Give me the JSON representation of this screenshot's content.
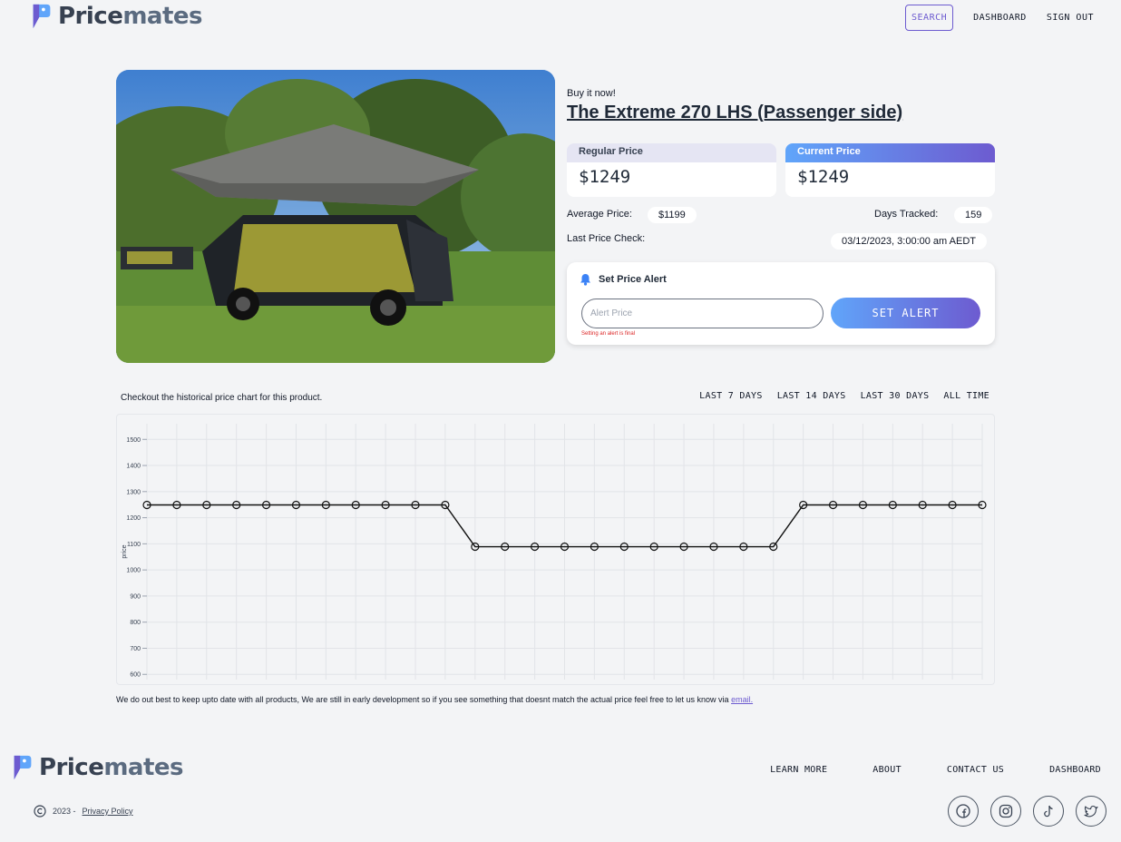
{
  "brand": {
    "name_part1": "Price",
    "name_part2": "mates"
  },
  "nav": {
    "search": "SEARCH",
    "dashboard": "DASHBOARD",
    "sign_out": "SIGN OUT"
  },
  "product": {
    "buy_label": "Buy it now!",
    "title": "The Extreme 270 LHS (Passenger side)",
    "regular_label": "Regular Price",
    "regular_price": "$1249",
    "current_label": "Current Price",
    "current_price": "$1249",
    "average_label": "Average Price:",
    "average_price": "$1199",
    "days_label": "Days Tracked:",
    "days_tracked": "159",
    "last_check_label": "Last Price Check:",
    "last_check": "03/12/2023, 3:00:00 am AEDT"
  },
  "alert": {
    "title": "Set Price Alert",
    "placeholder": "Alert Price",
    "note": "Setting an alert is final",
    "button": "SET ALERT"
  },
  "chart_section": {
    "caption": "Checkout the historical price chart for this product.",
    "ranges": [
      "LAST 7 DAYS",
      "LAST 14 DAYS",
      "LAST 30 DAYS",
      "ALL TIME"
    ],
    "disclaimer": "We do out best to keep upto date with all products, We are still in early development so if you see something that doesnt match the actual price feel free to let us know via",
    "email_link": "email."
  },
  "chart_data": {
    "type": "line",
    "ylabel": "price",
    "ylim": [
      580,
      1560
    ],
    "yticks": [
      600,
      700,
      800,
      900,
      1000,
      1100,
      1200,
      1300,
      1400,
      1500
    ],
    "values": [
      1249,
      1249,
      1249,
      1249,
      1249,
      1249,
      1249,
      1249,
      1249,
      1249,
      1249,
      1089,
      1089,
      1089,
      1089,
      1089,
      1089,
      1089,
      1089,
      1089,
      1089,
      1089,
      1249,
      1249,
      1249,
      1249,
      1249,
      1249,
      1249
    ],
    "grid": true
  },
  "footer": {
    "links": [
      "LEARN MORE",
      "ABOUT",
      "CONTACT US",
      "DASHBOARD"
    ],
    "year": "2023 -",
    "privacy": "Privacy Policy",
    "socials": [
      "facebook-icon",
      "instagram-icon",
      "tiktok-icon",
      "twitter-icon"
    ]
  },
  "colors": {
    "accent": "#6d5bd0",
    "gradient_start": "#60a5fa",
    "error": "#dc2626"
  }
}
